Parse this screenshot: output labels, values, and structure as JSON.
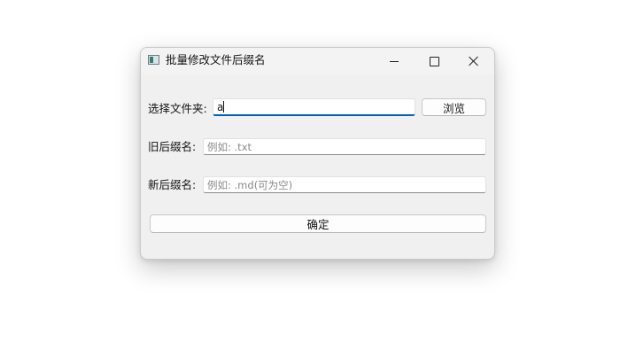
{
  "window": {
    "title": "批量修改文件后缀名",
    "icon": "app-window-icon"
  },
  "form": {
    "folder": {
      "label": "选择文件夹:",
      "value": "a",
      "browse_label": "浏览"
    },
    "old_suffix": {
      "label": "旧后缀名:",
      "placeholder": "例如: .txt"
    },
    "new_suffix": {
      "label": "新后缀名:",
      "placeholder": "例如: .md(可为空)"
    },
    "confirm_label": "确定"
  },
  "colors": {
    "focus_accent": "#005fb8",
    "window_bg": "#f0f0f0"
  }
}
